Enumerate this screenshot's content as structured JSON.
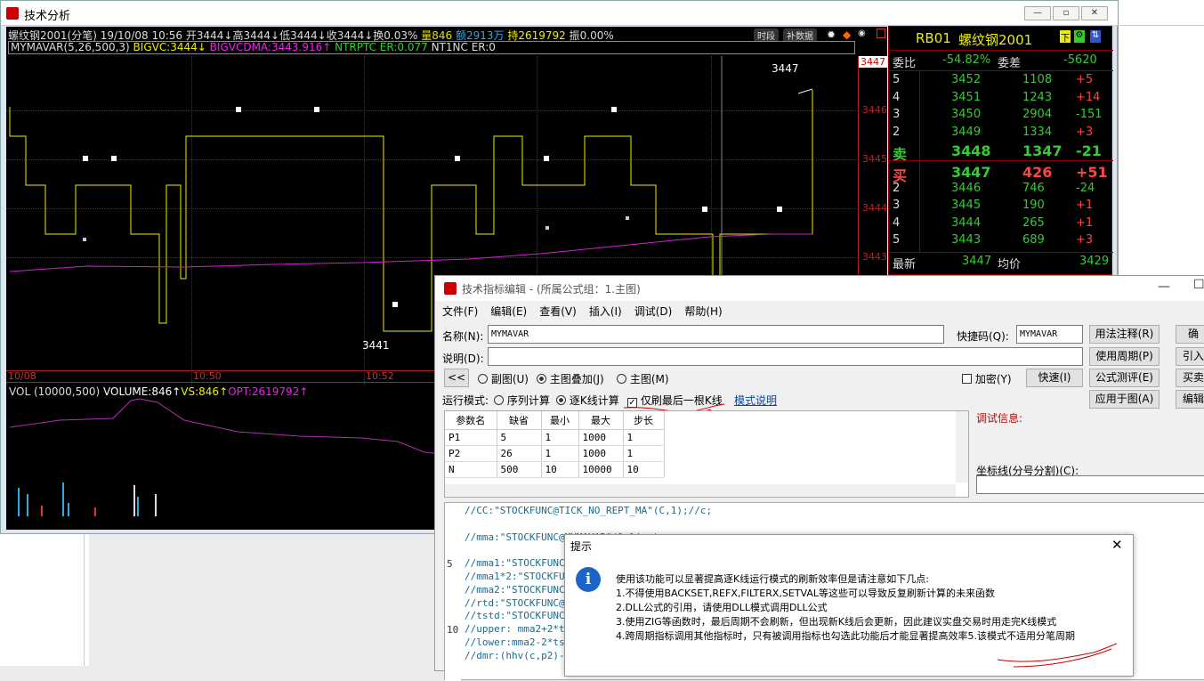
{
  "window": {
    "title": "技术分析"
  },
  "chart": {
    "infobar": {
      "symbol": "螺纹钢2001(分笔)",
      "datetime": "19/10/08 10:56",
      "open": "开3444↓",
      "high": "高3444↓",
      "low": "低3444↓",
      "close": "收3444↓",
      "turnover": "换0.03%",
      "volume": "量846",
      "amount": "额2913万",
      "hold": "持2619792",
      "amp": "振0.00%"
    },
    "btn_period": "时段",
    "btn_fill": "补数据",
    "indicator": {
      "name": "MYMAVAR(5,26,500,3)",
      "v1": "BIGVC:3444↓",
      "v2": "BIGVCDMA:3443.916↑",
      "v3": "NTRPTC  ER:0.077",
      "v4": "NT1NC  ER:0"
    },
    "price_labels": [
      "3447",
      "3446",
      "3445",
      "3444",
      "3443"
    ],
    "annot_high": "3447",
    "annot_low": "3441",
    "time_labels": [
      "10/08",
      "10:50",
      "10:52"
    ],
    "vol": {
      "title": "VOL (10000,500)",
      "volume": "VOLUME:846↑",
      "vs": "VS:846↑",
      "opt": "OPT:2619792↑"
    }
  },
  "quote": {
    "code": "RB01",
    "name": "螺纹钢2001",
    "ratio_label": "委比",
    "ratio": "-54.82%",
    "diff_label": "委差",
    "diff": "-5620",
    "asks": [
      [
        "5",
        "3452",
        "1108",
        "+5"
      ],
      [
        "4",
        "3451",
        "1243",
        "+14"
      ],
      [
        "3",
        "3450",
        "2904",
        "-151"
      ],
      [
        "2",
        "3449",
        "1334",
        "+3"
      ],
      [
        "卖",
        "3448",
        "1347",
        "-21"
      ]
    ],
    "bids": [
      [
        "买",
        "3447",
        "426",
        "+51"
      ],
      [
        "2",
        "3446",
        "746",
        "-24"
      ],
      [
        "3",
        "3445",
        "190",
        "+1"
      ],
      [
        "4",
        "3444",
        "265",
        "+1"
      ],
      [
        "5",
        "3443",
        "689",
        "+3"
      ]
    ],
    "last_label": "最新",
    "last": "3447",
    "avg_label": "均价",
    "avg": "3429"
  },
  "editor": {
    "title": "技术指标编辑 - (所属公式组：1.主图)",
    "menu": [
      "文件(F)",
      "编辑(E)",
      "查看(V)",
      "插入(I)",
      "调试(D)",
      "帮助(H)"
    ],
    "name_label": "名称(N):",
    "name_value": "MYMAVAR",
    "shortcut_label": "快捷码(Q):",
    "shortcut_value": "MYMAVAR",
    "desc_label": "说明(D):",
    "btn_note": "用法注释(R)",
    "btn_period": "使用周期(P)",
    "btn_test": "公式测评(E)",
    "btn_apply": "应用于图(A)",
    "btn_speed": "快速(I)",
    "btn_r1": "确",
    "btn_r2": "引入",
    "btn_r3": "买卖",
    "btn_r4": "编辑",
    "collapse": "<<",
    "radio_sub": "副图(U)",
    "radio_overlay": "主图叠加(J)",
    "radio_main": "主图(M)",
    "encrypt": "加密(Y)",
    "mode_label": "运行模式:",
    "mode_seq": "序列计算",
    "mode_bar": "逐K线计算",
    "mode_last": "仅刷最后一根K线",
    "mode_help": "模式说明",
    "debug_label": "调试信息:",
    "axis_label": "坐标线(分号分割)(C):",
    "params_header": [
      "参数名",
      "缺省",
      "最小",
      "最大",
      "步长"
    ],
    "params": [
      [
        "P1",
        "5",
        "1",
        "1000",
        "1"
      ],
      [
        "P2",
        "26",
        "1",
        "1000",
        "1"
      ],
      [
        "N",
        "500",
        "10",
        "10000",
        "10"
      ]
    ],
    "code": [
      "//CC:\"STOCKFUNC@TICK_NO_REPT_MA\"(C,1);//c;",
      "",
      "//mma:\"STOCKFUNC@MYMAVAR\"(1,lim ) ;",
      "",
      "//mma1:\"STOCKFUNC",
      "//mma1*2:\"STOCKFU",
      "//mma2:\"STOCKFUNC",
      "//rtd:\"STOCKFUNC@",
      "//tstd:\"STOCKFUNC",
      "//upper: mma2+2*t",
      "//lower:mma2-2*ts",
      "//dmr:(hhv(c,p2)-"
    ],
    "line_nums": [
      "5",
      "10"
    ]
  },
  "alert": {
    "title": "提示",
    "lines": [
      "使用该功能可以显著提高逐K线运行模式的刷新效率但是请注意如下几点:",
      "1.不得使用BACKSET,REFX,FILTERX,SETVAL等这些可以导致反复刷新计算的未来函数",
      "2.DLL公式的引用，请使用DLL模式调用DLL公式",
      "3.使用ZIG等函数时，最后周期不会刷新，但出现新K线后会更新，因此建议实盘交易时用走完K线模式",
      "4.跨周期指标调用其他指标时，只有被调用指标也勾选此功能后才能显著提高效率5.该模式不适用分笔周期"
    ]
  }
}
